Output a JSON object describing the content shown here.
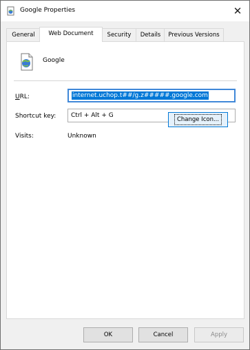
{
  "window": {
    "title": "Google Properties",
    "close_glyph": "✕"
  },
  "tabs": [
    {
      "label": "General",
      "active": false
    },
    {
      "label": "Web Document",
      "active": true
    },
    {
      "label": "Security",
      "active": false
    },
    {
      "label": "Details",
      "active": false
    },
    {
      "label": "Previous Versions",
      "active": false
    }
  ],
  "document": {
    "name": "Google",
    "icon": "web-document-icon"
  },
  "fields": {
    "url": {
      "label": "URL:",
      "value": "internet.uchop.t##/g.z#####.google.com"
    },
    "shortcut_key": {
      "label": "Shortcut key:",
      "value": "Ctrl + Alt + G"
    },
    "visits": {
      "label": "Visits:",
      "value": "Unknown"
    }
  },
  "buttons": {
    "change_icon": "Change Icon...",
    "ok": "OK",
    "cancel": "Cancel",
    "apply": "Apply"
  },
  "colors": {
    "accent": "#0078d7",
    "selection": "#0078d7"
  }
}
